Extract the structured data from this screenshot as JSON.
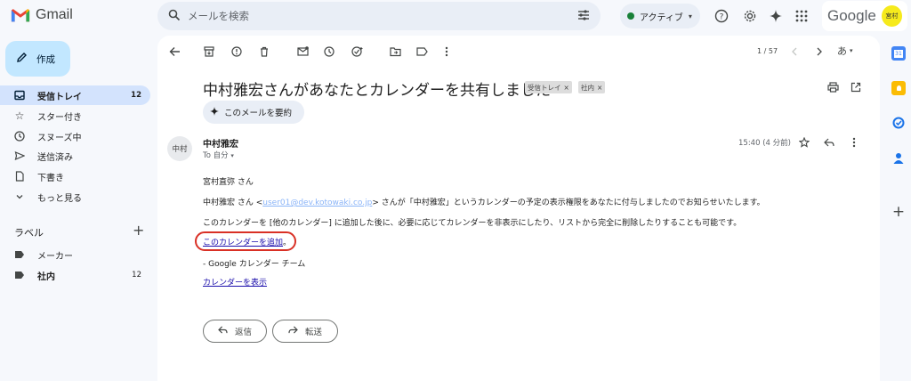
{
  "app": {
    "name": "Gmail",
    "google_word": "Google",
    "account_avatar": "宮村"
  },
  "search": {
    "placeholder": "メールを検索"
  },
  "status": {
    "label": "アクティブ"
  },
  "compose": {
    "label": "作成"
  },
  "nav": [
    {
      "label": "受信トレイ",
      "count": "12"
    },
    {
      "label": "スター付き",
      "count": ""
    },
    {
      "label": "スヌーズ中",
      "count": ""
    },
    {
      "label": "送信済み",
      "count": ""
    },
    {
      "label": "下書き",
      "count": ""
    },
    {
      "label": "もっと見る",
      "count": ""
    }
  ],
  "labels_section": {
    "title": "ラベル",
    "items": [
      {
        "label": "メーカー",
        "count": ""
      },
      {
        "label": "社内",
        "count": "12"
      }
    ]
  },
  "toolbar": {
    "pager": "1 / 57",
    "ime": "あ"
  },
  "email": {
    "subject": "中村雅宏さんがあなたとカレンダーを共有しました",
    "chips": [
      "受信トレイ",
      "社内"
    ],
    "summarize": "このメールを要約",
    "sender_initials": "中村",
    "sender": "中村雅宏",
    "to": "To 自分",
    "time": "15:40 (4 分前)",
    "greeting": "宮村直弥 さん",
    "line1_prefix": "中村雅宏 さん <",
    "line1_email": "user01@dev.kotowaki.co.jp",
    "line1_suffix": "> さんが「中村雅宏」というカレンダーの予定の表示権限をあなたに付与しましたのでお知らせいたします。",
    "line2": "このカレンダーを [他のカレンダー] に追加した後に、必要に応じてカレンダーを非表示にしたり、リストから完全に削除したりすることも可能です。",
    "add_link": "このカレンダーを追加",
    "add_link_tail": "。",
    "signature": "- Google カレンダー チーム",
    "view_link": "カレンダーを表示",
    "reply": "返信",
    "forward": "転送"
  },
  "colors": {
    "accent": "#c2e7ff",
    "active_nav": "#d3e3fd",
    "highlight": "#d93025"
  }
}
